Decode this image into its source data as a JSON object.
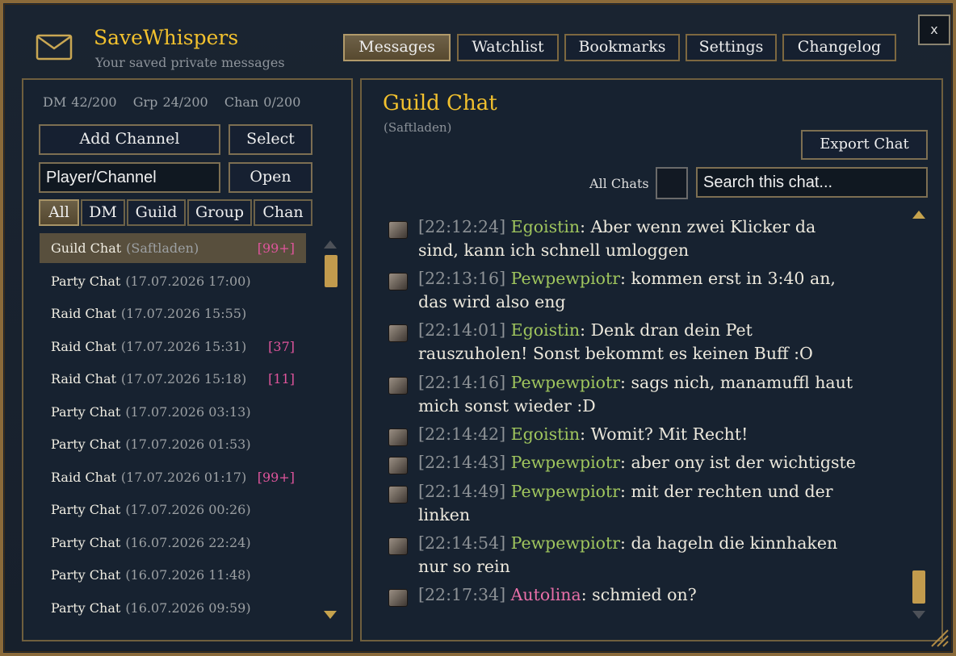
{
  "app": {
    "title": "SaveWhispers",
    "subtitle": "Your saved private messages",
    "close_label": "x"
  },
  "tabs": [
    {
      "label": "Messages",
      "active": true
    },
    {
      "label": "Watchlist",
      "active": false
    },
    {
      "label": "Bookmarks",
      "active": false
    },
    {
      "label": "Settings",
      "active": false
    },
    {
      "label": "Changelog",
      "active": false
    }
  ],
  "sidebar": {
    "stats": {
      "dm": "DM 42/200",
      "grp": "Grp 24/200",
      "chan": "Chan 0/200"
    },
    "add_channel_label": "Add Channel",
    "select_label": "Select",
    "open_label": "Open",
    "player_input": {
      "value": "Player/Channel"
    },
    "filters": [
      "All",
      "DM",
      "Guild",
      "Group",
      "Chan"
    ],
    "active_filter": "All",
    "chats": [
      {
        "name": "Guild Chat",
        "date": "(Saftladen)",
        "badge": "[99+]",
        "selected": true
      },
      {
        "name": "Party Chat",
        "date": "(17.07.2026 17:00)",
        "badge": ""
      },
      {
        "name": "Raid Chat",
        "date": "(17.07.2026 15:55)",
        "badge": ""
      },
      {
        "name": "Raid Chat",
        "date": "(17.07.2026 15:31)",
        "badge": "[37]"
      },
      {
        "name": "Raid Chat",
        "date": "(17.07.2026 15:18)",
        "badge": "[11]"
      },
      {
        "name": "Party Chat",
        "date": "(17.07.2026 03:13)",
        "badge": ""
      },
      {
        "name": "Party Chat",
        "date": "(17.07.2026 01:53)",
        "badge": ""
      },
      {
        "name": "Raid Chat",
        "date": "(17.07.2026 01:17)",
        "badge": "[99+]"
      },
      {
        "name": "Party Chat",
        "date": "(17.07.2026 00:26)",
        "badge": ""
      },
      {
        "name": "Party Chat",
        "date": "(16.07.2026 22:24)",
        "badge": ""
      },
      {
        "name": "Party Chat",
        "date": "(16.07.2026 11:48)",
        "badge": ""
      },
      {
        "name": "Party Chat",
        "date": "(16.07.2026 09:59)",
        "badge": ""
      }
    ]
  },
  "main": {
    "chat_title": "Guild Chat",
    "chat_subtitle": "(Saftladen)",
    "export_label": "Export Chat",
    "all_chats_label": "All Chats",
    "search": {
      "value": "Search this chat..."
    },
    "messages": [
      {
        "time": "[22:12:24]",
        "sender": "Egoistin",
        "color": "green",
        "lines": [
          "Aber wenn zwei Klicker da",
          "sind, kann ich schnell umloggen"
        ]
      },
      {
        "time": "[22:13:16]",
        "sender": "Pewpewpiotr",
        "color": "green",
        "lines": [
          "kommen erst in 3:40 an,",
          "das wird also eng"
        ]
      },
      {
        "time": "[22:14:01]",
        "sender": "Egoistin",
        "color": "green",
        "lines": [
          "Denk dran dein Pet",
          "rauszuholen! Sonst bekommt es keinen Buff :O"
        ]
      },
      {
        "time": "[22:14:16]",
        "sender": "Pewpewpiotr",
        "color": "green",
        "lines": [
          "sags nich, manamuffl haut",
          "mich sonst wieder :D"
        ]
      },
      {
        "time": "[22:14:42]",
        "sender": "Egoistin",
        "color": "green",
        "lines": [
          "Womit? Mit Recht!"
        ]
      },
      {
        "time": "[22:14:43]",
        "sender": "Pewpewpiotr",
        "color": "green",
        "lines": [
          "aber ony ist der wichtigste"
        ]
      },
      {
        "time": "[22:14:49]",
        "sender": "Pewpewpiotr",
        "color": "green",
        "lines": [
          "mit der rechten und der",
          "linken"
        ]
      },
      {
        "time": "[22:14:54]",
        "sender": "Pewpewpiotr",
        "color": "green",
        "lines": [
          "da hageln die kinnhaken",
          "nur so rein"
        ]
      },
      {
        "time": "[22:17:34]",
        "sender": "Autolina",
        "color": "pink",
        "lines": [
          "schmied on?"
        ]
      }
    ]
  },
  "colors": {
    "gold": "#f2c12e",
    "green_name": "#9fc55d",
    "pink_name": "#e86fa8",
    "badge": "#e0559c"
  }
}
